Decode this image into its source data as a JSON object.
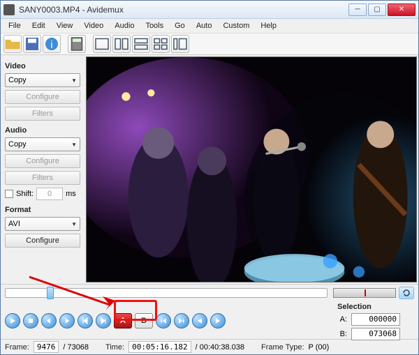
{
  "title": "SANY0003.MP4 - Avidemux",
  "menu": [
    "File",
    "Edit",
    "View",
    "Video",
    "Audio",
    "Tools",
    "Go",
    "Auto",
    "Custom",
    "Help"
  ],
  "sidebar": {
    "video": {
      "heading": "Video",
      "codec": "Copy",
      "configure": "Configure",
      "filters": "Filters"
    },
    "audio": {
      "heading": "Audio",
      "codec": "Copy",
      "configure": "Configure",
      "filters": "Filters",
      "shift_label": "Shift:",
      "shift_value": "0",
      "shift_unit": "ms"
    },
    "format": {
      "heading": "Format",
      "container": "AVI",
      "configure": "Configure"
    }
  },
  "selection": {
    "heading": "Selection",
    "a_label": "A:",
    "a_value": "000000",
    "b_label": "B:",
    "b_value": "073068"
  },
  "status": {
    "frame_label": "Frame:",
    "frame_cur": "9476",
    "frame_total": "/ 73068",
    "time_label": "Time:",
    "time_cur": "00:05:16.182",
    "time_total": "/ 00:40:38.038",
    "type_label": "Frame Type:",
    "type_value": "P (00)"
  },
  "marks": {
    "a": "A",
    "b": "B"
  },
  "scrub_percent": 12.9
}
